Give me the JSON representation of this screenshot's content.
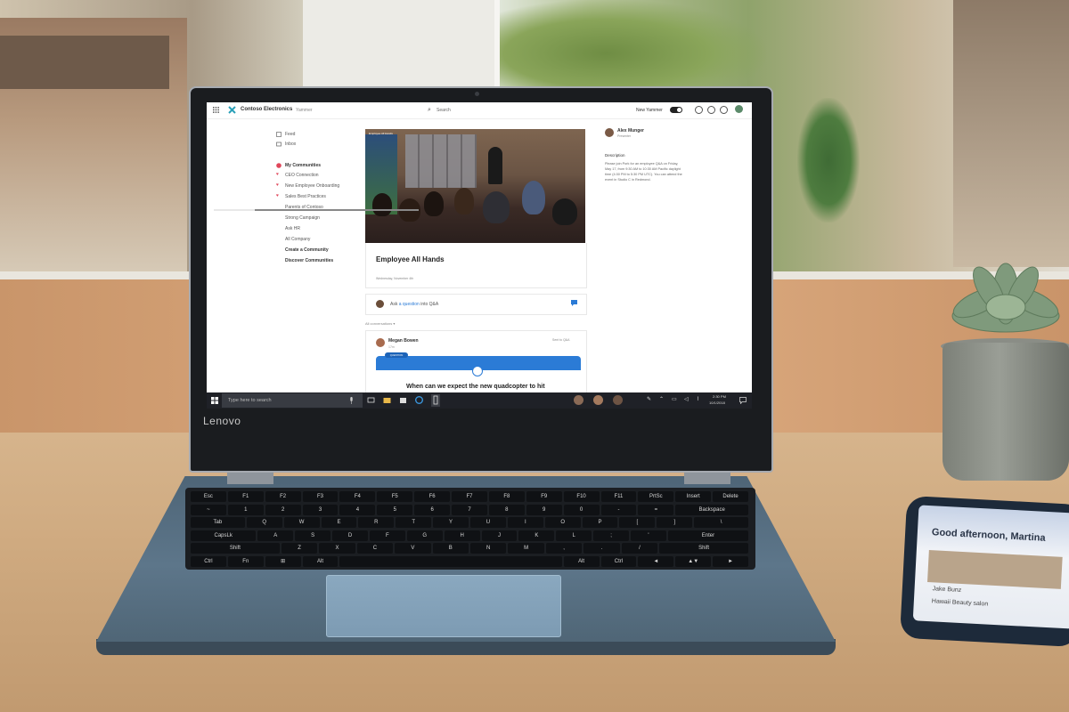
{
  "yammer": {
    "app_name": "Contoso Electronics",
    "product": "Yammer",
    "search_placeholder": "Search",
    "new_yammer_label": "New Yammer",
    "nav": {
      "feed": "Feed",
      "inbox": "Inbox",
      "my_communities": "My Communities",
      "communities": [
        "CEO Connection",
        "New Employee Onboarding",
        "Sales Best Practices",
        "Parents of Contoso",
        "Strong Campaign",
        "Ask HR",
        "All Company"
      ],
      "create_community": "Create a Community",
      "discover_communities": "Discover Communities"
    },
    "video": {
      "label": "Employee All Hands",
      "progress": 0.2
    },
    "event": {
      "title": "Employee All Hands",
      "date": "Wednesday, November 4th"
    },
    "qa": {
      "prompt_prefix": "Ask ",
      "prompt_link": "a question",
      "prompt_suffix": " into Q&A"
    },
    "conversations_filter": "All conversations ▾",
    "post": {
      "author": "Megan Bowen",
      "meta": "17m",
      "action": "Sent to Q&A",
      "tag": "QUESTION",
      "question": "When can we expect the new quadcopter to hit"
    },
    "presenter": {
      "name": "Alex Munger",
      "role": "Presenter",
      "description_label": "Description",
      "description": "Please join Pork for an employee Q&A on Friday, May 17, from 9:30 AM to 10:30 AM Pacific daylight time (4:30 PM to 5:30 PM UTC). You can attend the event in Studio C in Redmond."
    }
  },
  "taskbar": {
    "search_placeholder": "Type here to search",
    "time": "2:30 PM",
    "date": "10/1/2018"
  },
  "laptop": {
    "brand": "Lenovo"
  },
  "phone": {
    "greeting": "Good afternoon, Martina",
    "line1": "Jake Bunz",
    "line2": "Hawaii Beauty salon"
  },
  "keyboard": {
    "row1": [
      "Esc",
      "F1",
      "F2",
      "F3",
      "F4",
      "F5",
      "F6",
      "F7",
      "F8",
      "F9",
      "F10",
      "F11",
      "PrtSc",
      "Insert",
      "Delete"
    ],
    "row2": [
      "~",
      "1",
      "2",
      "3",
      "4",
      "5",
      "6",
      "7",
      "8",
      "9",
      "0",
      "-",
      "=",
      "Backspace"
    ],
    "row3": [
      "Tab",
      "Q",
      "W",
      "E",
      "R",
      "T",
      "Y",
      "U",
      "I",
      "O",
      "P",
      "[",
      "]",
      "\\"
    ],
    "row4": [
      "CapsLk",
      "A",
      "S",
      "D",
      "F",
      "G",
      "H",
      "J",
      "K",
      "L",
      ";",
      "'",
      "Enter"
    ],
    "row5": [
      "Shift",
      "Z",
      "X",
      "C",
      "V",
      "B",
      "N",
      "M",
      ",",
      ".",
      "/",
      "Shift"
    ],
    "row6": [
      "Ctrl",
      "Fn",
      "⊞",
      "Alt",
      "",
      "Alt",
      "Ctrl",
      "◄",
      "▲▼",
      "►"
    ]
  },
  "colors": {
    "yammer_blue": "#2b7bd6",
    "taskbar": "#1f2127",
    "laptop_body": "#5d768a"
  }
}
